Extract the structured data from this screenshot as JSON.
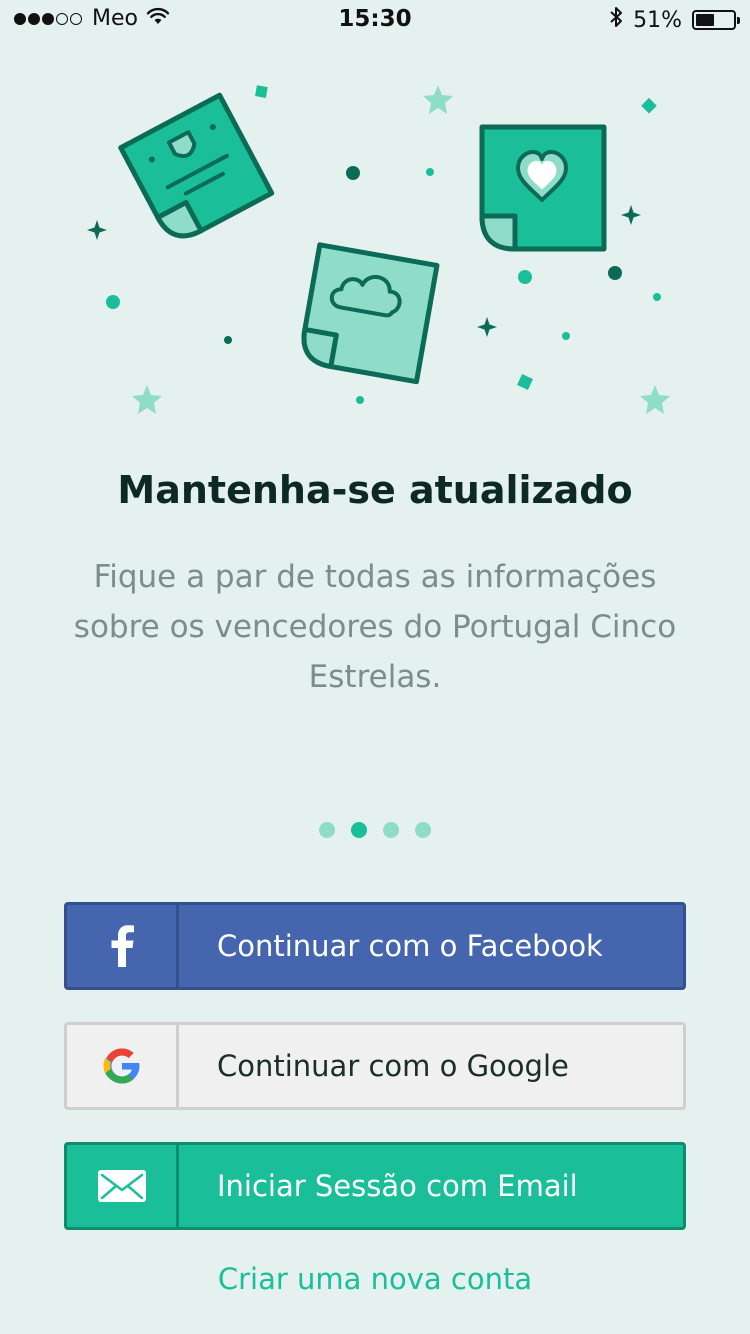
{
  "status_bar": {
    "signal_strength": 3,
    "signal_max": 5,
    "carrier": "Meo",
    "time": "15:30",
    "battery_percent": "51%",
    "battery_level": 0.51
  },
  "onboarding": {
    "title": "Mantenha-se atualizado",
    "description": "Fique a par de todas as informações sobre os vencedores do Portugal Cinco Estrelas.",
    "pager": {
      "total": 4,
      "active_index": 1,
      "active_color": "#1abf99",
      "inactive_color": "#8fdcc8"
    }
  },
  "buttons": {
    "facebook_label": "Continuar com o Facebook",
    "google_label": "Continuar com o Google",
    "email_label": "Iniciar Sessão com Email"
  },
  "links": {
    "create_account": "Criar uma nova conta"
  },
  "colors": {
    "background": "#e5f1ee",
    "accent": "#1abf99",
    "facebook": "#4566ae",
    "title": "#0c2a22",
    "description": "#7b8e89"
  },
  "icons": {
    "facebook": "facebook-icon",
    "google": "google-icon",
    "email": "envelope-icon"
  }
}
